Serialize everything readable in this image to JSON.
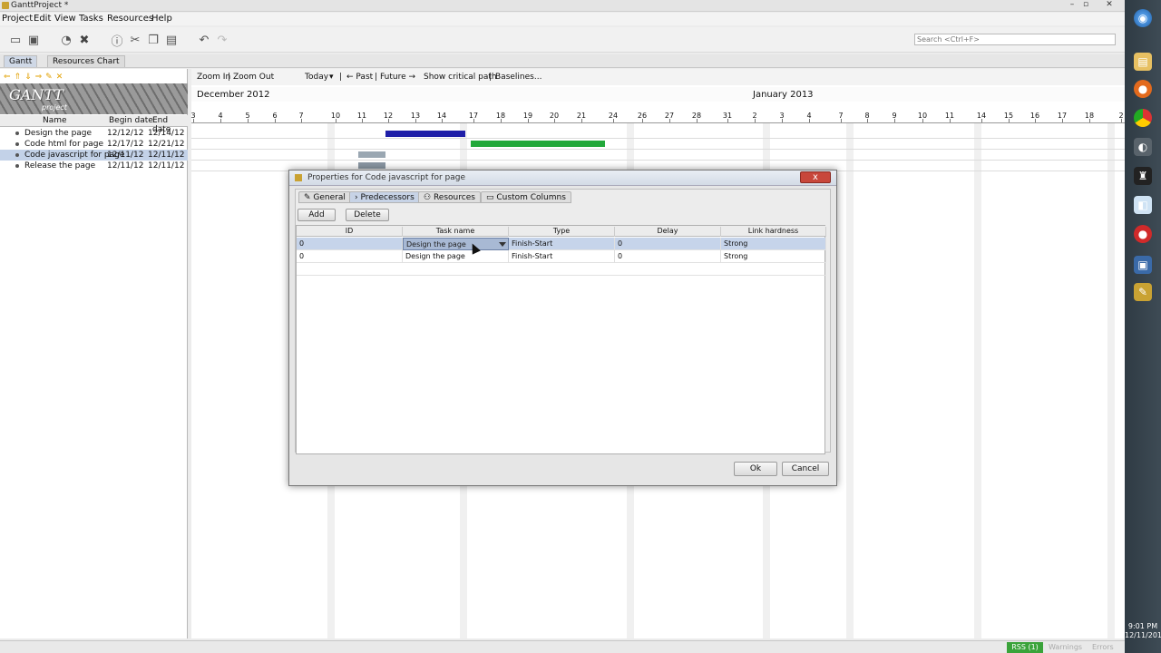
{
  "window": {
    "title": "GanttProject *"
  },
  "menu": [
    "Project",
    "Edit",
    "View",
    "Tasks",
    "Resources",
    "Help"
  ],
  "search": {
    "placeholder": "Search <Ctrl+F>"
  },
  "tabs": [
    {
      "label": "Gantt"
    },
    {
      "label": "Resources Chart"
    }
  ],
  "logo": {
    "main": "GANTT",
    "sub": "project"
  },
  "task_table": {
    "headers": {
      "name": "Name",
      "begin": "Begin date",
      "end": "End date"
    },
    "rows": [
      {
        "name": "Design the page",
        "begin": "12/12/12",
        "end": "12/14/12"
      },
      {
        "name": "Code html for page",
        "begin": "12/17/12",
        "end": "12/21/12"
      },
      {
        "name": "Code javascript for page",
        "begin": "12/11/12",
        "end": "12/11/12"
      },
      {
        "name": "Release the page",
        "begin": "12/11/12",
        "end": "12/11/12"
      }
    ]
  },
  "gantt_toolbar": {
    "zoom_in": "Zoom In",
    "sep": "|",
    "zoom_out": "Zoom Out",
    "today": "Today",
    "past": "← Past",
    "future": "Future →",
    "critical": "Show critical path",
    "baselines": "Baselines..."
  },
  "timeline": {
    "month1": "December 2012",
    "month2": "January 2013",
    "days": [
      "3",
      "4",
      "5",
      "6",
      "7",
      "10",
      "11",
      "12",
      "13",
      "14",
      "17",
      "18",
      "19",
      "20",
      "21",
      "24",
      "26",
      "27",
      "28",
      "31",
      "2",
      "3",
      "4",
      "7",
      "8",
      "9",
      "10",
      "11",
      "14",
      "15",
      "16",
      "17",
      "18",
      "2"
    ]
  },
  "dialog": {
    "title": "Properties for Code javascript for page",
    "tabs": [
      "General",
      "Predecessors",
      "Resources",
      "Custom Columns"
    ],
    "add": "Add",
    "delete": "Delete",
    "headers": {
      "id": "ID",
      "task": "Task name",
      "type": "Type",
      "delay": "Delay",
      "hardness": "Link hardness"
    },
    "rows": [
      {
        "id": "0",
        "task": "Design the page",
        "type": "Finish-Start",
        "delay": "0",
        "hardness": "Strong"
      },
      {
        "id": "0",
        "task": "Design the page",
        "type": "Finish-Start",
        "delay": "0",
        "hardness": "Strong"
      }
    ],
    "ok": "Ok",
    "cancel": "Cancel",
    "close": "x"
  },
  "status": {
    "rss": "RSS (1)",
    "warnings": "Warnings",
    "errors": "Errors"
  },
  "clock": {
    "time": "9:01 PM",
    "date": "12/11/2012"
  },
  "colors": {
    "bar_blue": "#1f1fa8",
    "bar_green": "#22a83a",
    "bar_gray": "#9aa7b2",
    "selection": "#c3d2e8"
  }
}
